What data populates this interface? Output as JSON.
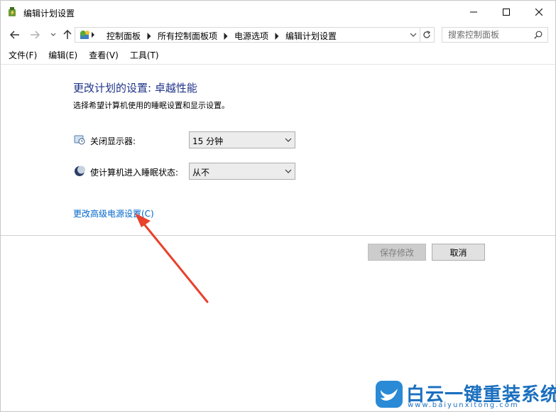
{
  "window": {
    "title": "编辑计划设置",
    "icons": {
      "app": "power-options-icon",
      "minimize": "minimize-icon",
      "maximize": "maximize-icon",
      "close": "close-icon"
    }
  },
  "nav": {
    "icons": {
      "back": "back-arrow-icon",
      "forward": "forward-arrow-icon",
      "recent": "chevron-down-icon",
      "up": "up-arrow-icon",
      "refresh": "refresh-icon"
    }
  },
  "address": {
    "breadcrumbs": [
      "控制面板",
      "所有控制面板项",
      "电源选项",
      "编辑计划设置"
    ],
    "location_icon": "control-panel-icon"
  },
  "search": {
    "placeholder": "搜索控制面板",
    "icon": "search-icon"
  },
  "menu": {
    "items": [
      "文件(F)",
      "编辑(E)",
      "查看(V)",
      "工具(T)"
    ]
  },
  "main": {
    "title": "更改计划的设置: 卓越性能",
    "description": "选择希望计算机使用的睡眠设置和显示设置。",
    "settings": [
      {
        "label": "关闭显示器:",
        "value": "15 分钟",
        "icon": "display-timer-icon"
      },
      {
        "label": "使计算机进入睡眠状态:",
        "value": "从不",
        "icon": "sleep-moon-icon"
      }
    ],
    "advanced_link": "更改高级电源设置(C)",
    "buttons": {
      "save": "保存修改",
      "cancel": "取消"
    }
  },
  "watermark": {
    "text": "白云一键重装系统",
    "subtext": "www.baiyunxitong.com"
  },
  "colors": {
    "title": "#1e3287",
    "link": "#0066cc",
    "annotation_arrow": "#e8412c",
    "watermark": "#1a6fbf"
  }
}
